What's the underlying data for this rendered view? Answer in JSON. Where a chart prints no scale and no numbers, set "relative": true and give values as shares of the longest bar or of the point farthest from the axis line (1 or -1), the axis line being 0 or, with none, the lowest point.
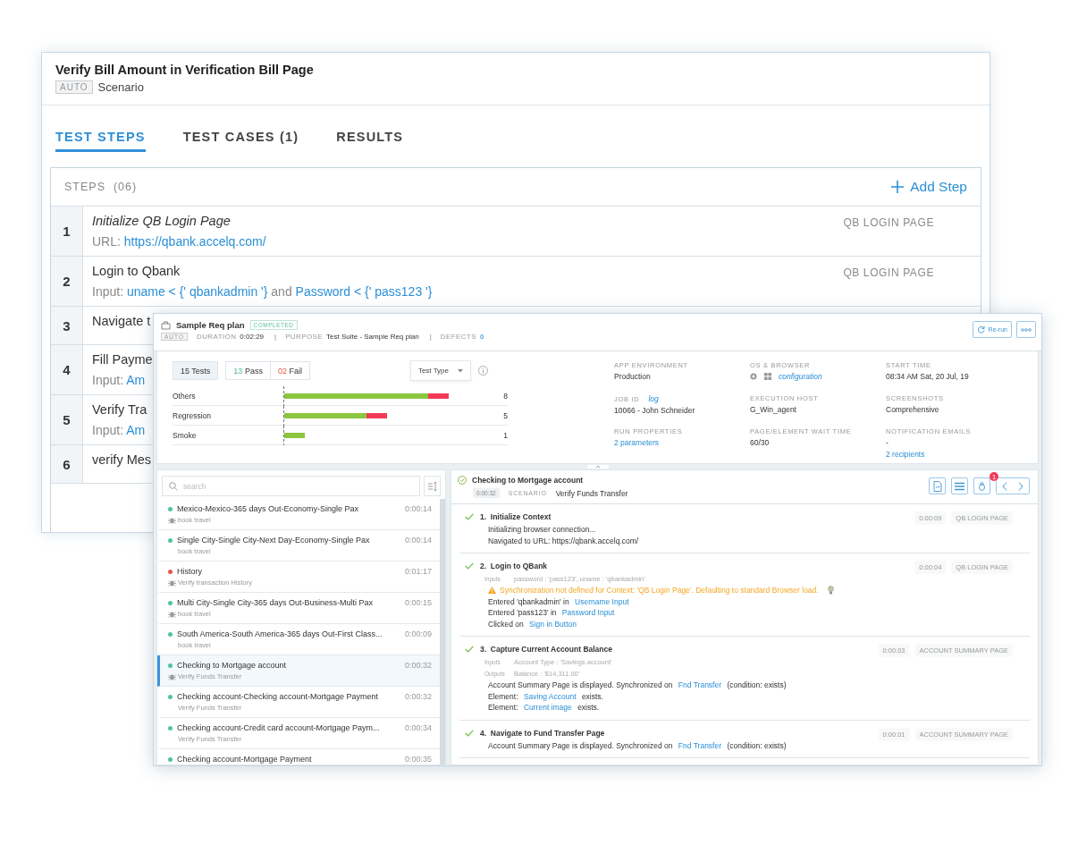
{
  "scenario_window": {
    "title": "Verify Bill Amount in Verification Bill Page",
    "badge": "AUTO",
    "type": "Scenario",
    "tabs": [
      {
        "label": "TEST STEPS",
        "selected": true
      },
      {
        "label": "TEST CASES (1)",
        "selected": false
      },
      {
        "label": "RESULTS",
        "selected": false
      }
    ],
    "steps_header": {
      "label": "STEPS",
      "count": "(06)",
      "add_button": "Add Step"
    },
    "steps": [
      {
        "number": "1",
        "title": "Initialize QB Login Page",
        "italic": true,
        "page": "QB LOGIN PAGE",
        "detail": [
          {
            "text": "URL: ",
            "link": false
          },
          {
            "text": "https://qbank.accelq.com/",
            "link": true
          }
        ]
      },
      {
        "number": "2",
        "title": "Login to Qbank",
        "italic": false,
        "page": "QB LOGIN PAGE",
        "detail": [
          {
            "text": "Input: ",
            "link": false
          },
          {
            "text": "uname < {' qbankadmin '}",
            "link": true
          },
          {
            "text": " and ",
            "link": false
          },
          {
            "text": "Password < {' pass123 '}",
            "link": true
          }
        ]
      },
      {
        "number": "3",
        "title": "Navigate t",
        "italic": false
      },
      {
        "number": "4",
        "title": "Fill Payme",
        "italic": false,
        "detail": [
          {
            "text": "Input: ",
            "link": false
          },
          {
            "text": "Am",
            "link": true
          }
        ]
      },
      {
        "number": "5",
        "title": "Verify Tra",
        "italic": false,
        "detail": [
          {
            "text": "Input: ",
            "link": false
          },
          {
            "text": "Am",
            "link": true
          }
        ]
      },
      {
        "number": "6",
        "title": "verify Mes",
        "italic": false
      }
    ]
  },
  "run_window": {
    "title": "Sample Req plan",
    "status": "COMPLETED",
    "badge": "AUTO",
    "meta": [
      {
        "kind": "field",
        "label": "DURATION",
        "value": "0:02:29"
      },
      {
        "kind": "separator",
        "text": "|"
      },
      {
        "kind": "field",
        "label": "PURPOSE",
        "value": "Test Suite - Sample Req plan"
      },
      {
        "kind": "separator",
        "text": "|"
      },
      {
        "kind": "link_field",
        "label": "DEFECTS",
        "value": "6"
      }
    ],
    "rerun_button": "Re-run",
    "summary": {
      "total": {
        "count": "15",
        "label": "Tests"
      },
      "pass": {
        "count": "13",
        "label": "Pass"
      },
      "fail": {
        "count": "02",
        "label": "Fail"
      },
      "group_by": "Test Type",
      "chart_data": {
        "type": "bar",
        "orientation": "horizontal",
        "stacked": true,
        "relative": true,
        "grid": true,
        "categories": [
          "Others",
          "Regression",
          "Smoke"
        ],
        "series": [
          {
            "color": "#8cc63f",
            "values": [
              0.875,
              0.5,
              0.125
            ]
          },
          {
            "color": "#f23a56",
            "values": [
              0.125,
              0.125,
              0
            ]
          }
        ],
        "value_labels": [
          "8",
          "5",
          "1"
        ]
      },
      "fields": [
        {
          "kind": "plain",
          "label": "APP ENVIRONMENT",
          "values": [
            {
              "text": "Production",
              "link": false
            }
          ]
        },
        {
          "kind": "browser",
          "label": "OS & BROWSER",
          "values": [
            {
              "text": "configuration",
              "link": true
            }
          ]
        },
        {
          "kind": "plain",
          "label": "START TIME",
          "values": [
            {
              "text": "08:34 AM Sat, 20 Jul, 19",
              "link": false
            }
          ]
        },
        {
          "kind": "plain",
          "label": "JOB ID",
          "label_link": "log",
          "values": [
            {
              "text": "10066 - John Schneider",
              "link": false
            }
          ]
        },
        {
          "kind": "plain",
          "label": "EXECUTION HOST",
          "values": [
            {
              "text": "G_Win_agent",
              "link": false
            }
          ]
        },
        {
          "kind": "plain",
          "label": "SCREENSHOTS",
          "values": [
            {
              "text": "Comprehensive",
              "link": false
            }
          ]
        },
        {
          "kind": "plain",
          "label": "RUN PROPERTIES",
          "values": [
            {
              "text": "2 parameters",
              "link": true
            }
          ]
        },
        {
          "kind": "plain",
          "label": "PAGE/ELEMENT WAIT TIME",
          "values": [
            {
              "text": "60/30",
              "link": false
            }
          ]
        },
        {
          "kind": "plain",
          "label": "NOTIFICATION EMAILS",
          "values": [
            {
              "text": "-",
              "link": false
            },
            {
              "text": "2 recipients",
              "link": true
            }
          ]
        }
      ]
    },
    "list": {
      "search_placeholder": "search",
      "items": [
        {
          "title": "Mexico-Mexico-365 days Out-Economy-Single Pax",
          "time": "0:00:14",
          "subtitle": "book travel",
          "color": "#4fc3a1",
          "defect": true,
          "selected": false
        },
        {
          "title": "Single City-Single City-Next Day-Economy-Single Pax",
          "time": "0:00:14",
          "subtitle": "book travel",
          "color": "#4fc3a1",
          "defect": false,
          "selected": false
        },
        {
          "title": "History",
          "time": "0:01:17",
          "subtitle": "Verify transaction History",
          "color": "#e8574a",
          "defect": true,
          "selected": false
        },
        {
          "title": "Multi City-Single City-365 days Out-Business-Multi Pax",
          "time": "0:00:15",
          "subtitle": "book travel",
          "color": "#4fc3a1",
          "defect": true,
          "selected": false
        },
        {
          "title": "South America-South America-365 days Out-First Class...",
          "time": "0:00:09",
          "subtitle": "book travel",
          "color": "#4fc3a1",
          "defect": false,
          "selected": false
        },
        {
          "title": "Checking to Mortgage account",
          "time": "0:00:32",
          "subtitle": "Verify Funds Transfer",
          "color": "#4fc3a1",
          "defect": true,
          "selected": true
        },
        {
          "title": "Checking account-Checking account-Mortgage Payment",
          "time": "0:00:32",
          "subtitle": "Verify Funds Transfer",
          "color": "#4fc3a1",
          "defect": false,
          "selected": false
        },
        {
          "title": "Checking account-Credit card account-Mortgage Paym...",
          "time": "0:00:34",
          "subtitle": "Verify Funds Transfer",
          "color": "#4fc3a1",
          "defect": false,
          "selected": false
        },
        {
          "title": "Checking account-Mortgage Payment",
          "time": "0:00:35",
          "color": "#4fc3a1",
          "defect": false,
          "selected": false
        }
      ]
    },
    "detail": {
      "title": "Checking to Mortgage account",
      "duration": "0:00:32",
      "type_label": "SCENARIO",
      "scenario": "Verify Funds Transfer",
      "defects_badge": "1",
      "steps": [
        {
          "number": "1.",
          "title": "Initialize Context",
          "time": "0:00:09",
          "page": "QB LOGIN PAGE",
          "passed": true,
          "lines": [
            {
              "kind": "text",
              "parts": [
                {
                  "text": "Initializing browser connection...",
                  "link": false
                }
              ]
            },
            {
              "kind": "text",
              "parts": [
                {
                  "text": "Navigated to URL: https://qbank.accelq.com/",
                  "link": false
                }
              ]
            }
          ]
        },
        {
          "number": "2.",
          "title": "Login to QBank",
          "time": "0:00:04",
          "page": "QB LOGIN PAGE",
          "passed": true,
          "lines": [
            {
              "kind": "io",
              "label": "Inputs",
              "value": "password : 'pass123', uname : 'qbankadmin'"
            },
            {
              "kind": "warning",
              "text": "Synchronization not defined for Context: 'QB Login Page'. Defaulting to standard Browser load."
            },
            {
              "kind": "text",
              "parts": [
                {
                  "text": "Entered 'qbankadmin' in ",
                  "link": false
                },
                {
                  "text": "Username Input",
                  "link": true
                }
              ]
            },
            {
              "kind": "text",
              "parts": [
                {
                  "text": "Entered 'pass123' in ",
                  "link": false
                },
                {
                  "text": "Password Input",
                  "link": true
                }
              ]
            },
            {
              "kind": "text",
              "parts": [
                {
                  "text": "Clicked on ",
                  "link": false
                },
                {
                  "text": "Sign in Button",
                  "link": true
                }
              ]
            }
          ]
        },
        {
          "number": "3.",
          "title": "Capture Current Account Balance",
          "time": "0:00:03",
          "page": "ACCOUNT SUMMARY PAGE",
          "passed": true,
          "lines": [
            {
              "kind": "io",
              "label": "Inputs",
              "value": "Account Type : 'Savings account'"
            },
            {
              "kind": "io",
              "label": "Outputs",
              "value": "Balance : '$14,311.00'"
            },
            {
              "kind": "text",
              "parts": [
                {
                  "text": "Account Summary Page is displayed. Synchronized on ",
                  "link": false
                },
                {
                  "text": "Fnd Transfer",
                  "link": true
                },
                {
                  "text": " (condition: exists)",
                  "link": false
                }
              ]
            },
            {
              "kind": "text",
              "parts": [
                {
                  "text": "Element: ",
                  "link": false
                },
                {
                  "text": "Saving Account",
                  "link": true
                },
                {
                  "text": " exists.",
                  "link": false
                }
              ]
            },
            {
              "kind": "text",
              "parts": [
                {
                  "text": "Element: ",
                  "link": false
                },
                {
                  "text": "Current image",
                  "link": true
                },
                {
                  "text": " exists.",
                  "link": false
                }
              ]
            }
          ]
        },
        {
          "number": "4.",
          "title": "Navigate to Fund Transfer Page",
          "time": "0:00:01",
          "page": "ACCOUNT SUMMARY PAGE",
          "passed": true,
          "lines": [
            {
              "kind": "text",
              "parts": [
                {
                  "text": "Account Summary Page is displayed. Synchronized on ",
                  "link": false
                },
                {
                  "text": "Fnd Transfer",
                  "link": true
                },
                {
                  "text": " (condition: exists)",
                  "link": false
                }
              ]
            }
          ]
        }
      ]
    }
  }
}
